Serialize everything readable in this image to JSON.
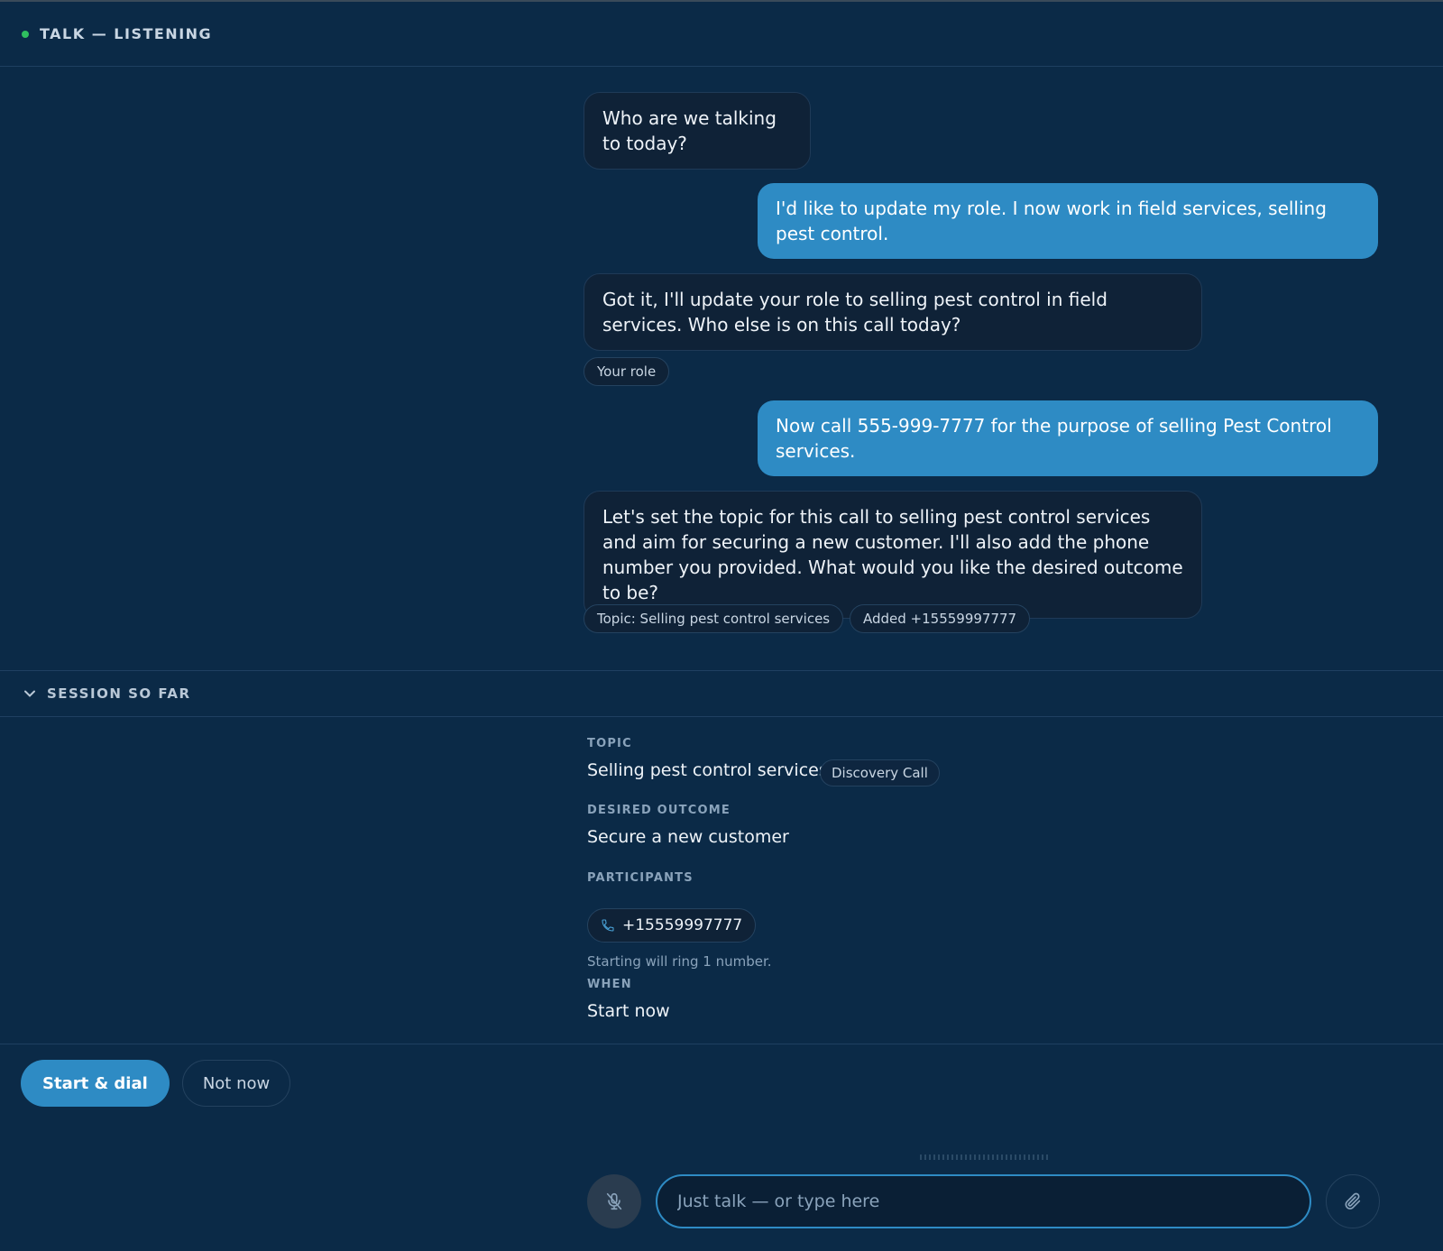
{
  "header": {
    "title": "TALK — LISTENING"
  },
  "messages": [
    {
      "role": "assistant",
      "text": "Who are we talking to today?"
    },
    {
      "role": "user",
      "text": "I'd like to update my role. I now work in field services, selling pest control."
    },
    {
      "role": "assistant",
      "text": "Got it, I'll update your role to selling pest control in field services. Who else is on this call today?"
    },
    {
      "role": "user",
      "text": "Now call 555-999-7777 for the purpose of selling Pest Control services."
    },
    {
      "role": "assistant",
      "text": "Let's set the topic for this call to selling pest control services and aim for securing a new customer. I'll also add the phone number you provided. What would you like the desired outcome to be?"
    }
  ],
  "chips": {
    "role": "Your role",
    "topic": "Topic: Selling pest control services",
    "added": "Added +15559997777"
  },
  "session": {
    "title": "SESSION SO FAR",
    "topic_label": "TOPIC",
    "topic_value": "Selling pest control services",
    "topic_tag": "Discovery Call",
    "outcome_label": "DESIRED OUTCOME",
    "outcome_value": "Secure a new customer",
    "participants_label": "PARTICIPANTS",
    "participant_phone": "+15559997777",
    "ring_hint": "Starting will ring 1 number.",
    "when_label": "WHEN",
    "when_value": "Start now"
  },
  "actions": {
    "primary": "Start & dial",
    "secondary": "Not now"
  },
  "composer": {
    "placeholder": "Just talk — or type here"
  },
  "icons": {
    "status": "status-dot",
    "chevron": "chevron-down-icon",
    "phone": "phone-icon",
    "mic": "mic-off-icon",
    "attach": "paperclip-icon"
  },
  "colors": {
    "accent": "#2e8bc4",
    "background": "#0b2a47",
    "status": "#2fbf5f"
  }
}
